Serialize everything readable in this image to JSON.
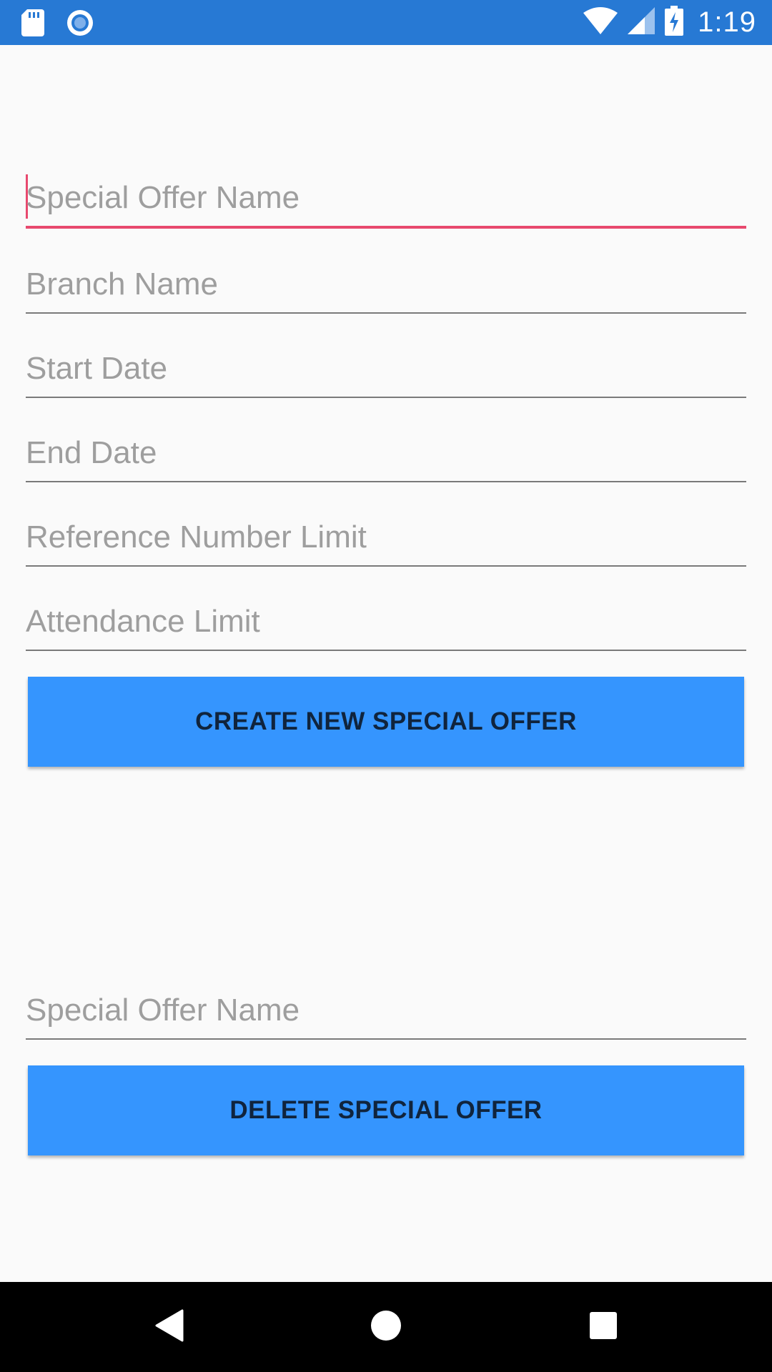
{
  "status_bar": {
    "time": "1:19",
    "icons": [
      "sd-card-icon",
      "sync-circle-icon",
      "wifi-icon",
      "signal-icon",
      "battery-charging-icon"
    ]
  },
  "form": {
    "fields": [
      {
        "placeholder": "Special Offer Name",
        "value": "",
        "focused": true
      },
      {
        "placeholder": "Branch Name",
        "value": ""
      },
      {
        "placeholder": "Start Date",
        "value": ""
      },
      {
        "placeholder": "End Date",
        "value": ""
      },
      {
        "placeholder": "Reference Number Limit",
        "value": ""
      },
      {
        "placeholder": "Attendance Limit",
        "value": ""
      }
    ],
    "create_button_label": "CREATE NEW SPECIAL OFFER"
  },
  "delete_section": {
    "field": {
      "placeholder": "Special Offer Name",
      "value": ""
    },
    "delete_button_label": "DELETE SPECIAL OFFER"
  },
  "colors": {
    "status_bar": "#2779d4",
    "button": "#3595fe",
    "focus_accent": "#e8496e",
    "background": "#fafafa"
  },
  "nav_bar": {
    "icons": [
      "back-icon",
      "home-icon",
      "recents-icon"
    ]
  }
}
